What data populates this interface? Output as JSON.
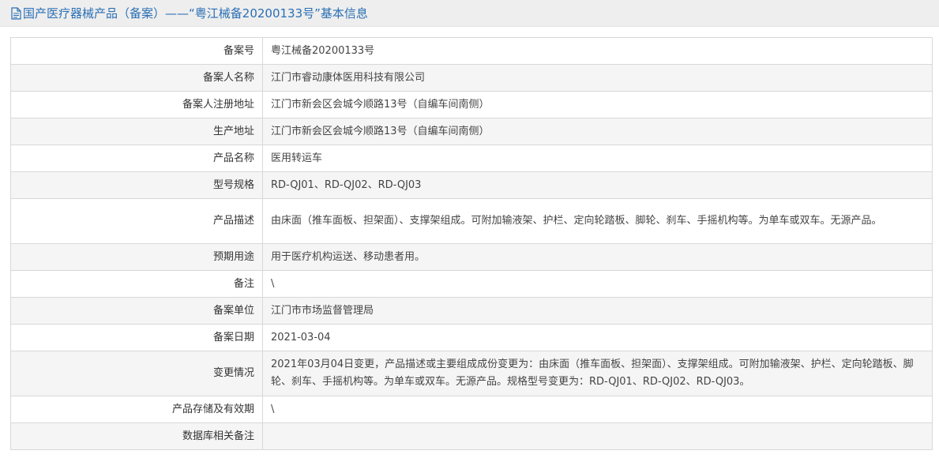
{
  "header": {
    "title": "国产医疗器械产品（备案）——“粤江械备20200133号”基本信息",
    "icon": "document-icon",
    "accent_color": "#2a6fb4"
  },
  "rows": [
    {
      "label": "备案号",
      "value": "粤江械备20200133号"
    },
    {
      "label": "备案人名称",
      "value": "江门市睿动康体医用科技有限公司"
    },
    {
      "label": "备案人注册地址",
      "value": "江门市新会区会城今顺路13号（自编车间南侧）"
    },
    {
      "label": "生产地址",
      "value": "江门市新会区会城今顺路13号（自编车间南侧）"
    },
    {
      "label": "产品名称",
      "value": "医用转运车"
    },
    {
      "label": "型号规格",
      "value": "RD-QJ01、RD-QJ02、RD-QJ03"
    },
    {
      "label": "产品描述",
      "value": "由床面（推车面板、担架面）、支撑架组成。可附加输液架、护栏、定向轮踏板、脚轮、刹车、手摇机构等。为单车或双车。无源产品。"
    },
    {
      "label": "预期用途",
      "value": "用于医疗机构运送、移动患者用。"
    },
    {
      "label": "备注",
      "value": "\\"
    },
    {
      "label": "备案单位",
      "value": "江门市市场监督管理局"
    },
    {
      "label": "备案日期",
      "value": "2021-03-04"
    },
    {
      "label": "变更情况",
      "value": "2021年03月04日变更，产品描述或主要组成成份变更为：由床面（推车面板、担架面）、支撑架组成。可附加输液架、护栏、定向轮踏板、脚轮、刹车、手摇机构等。为单车或双车。无源产品。规格型号变更为：RD-QJ01、RD-QJ02、RD-QJ03。"
    },
    {
      "label": "产品存储及有效期",
      "value": "\\"
    },
    {
      "label": "数据库相关备注",
      "value": ""
    }
  ]
}
